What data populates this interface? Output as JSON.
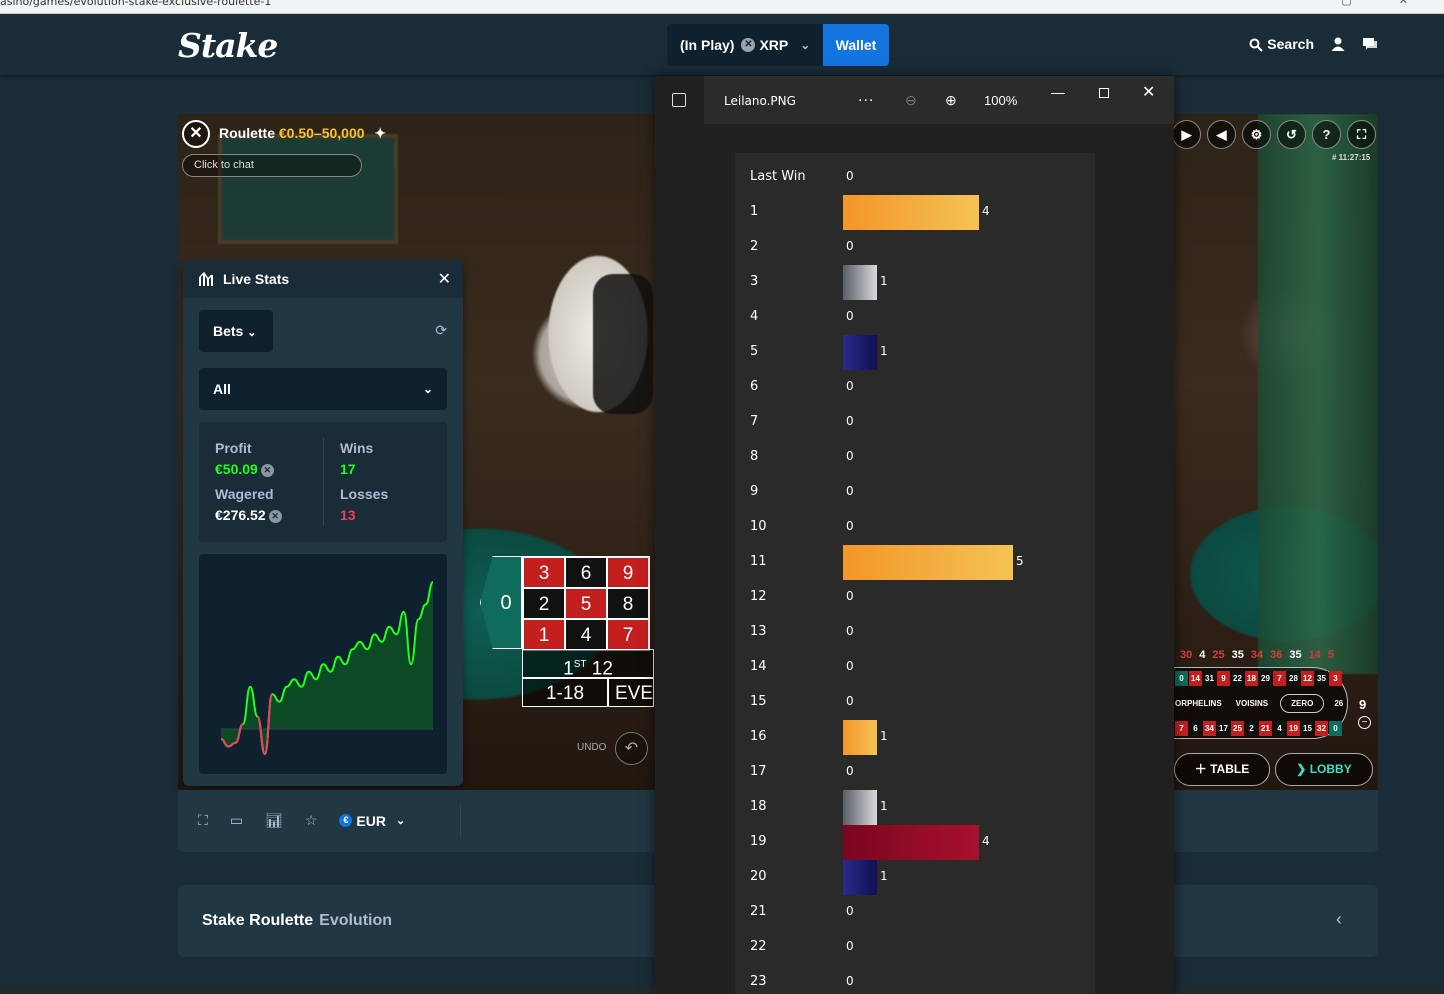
{
  "browser": {
    "url": "asino/games/evolution-stake-exclusive-roulette-1"
  },
  "header": {
    "logo": "Stake",
    "balance_label": "(In Play)",
    "currency": "XRP",
    "wallet_label": "Wallet",
    "search_label": "Search"
  },
  "game": {
    "title": "Roulette",
    "limits": "€0.50–50,000",
    "chat_placeholder": "Click to chat",
    "timestamp": "# 11:27:15",
    "board": {
      "zero": "0",
      "rows": [
        [
          "3",
          "6",
          "9"
        ],
        [
          "2",
          "5",
          "8"
        ],
        [
          "1",
          "4",
          "7"
        ]
      ],
      "row_colors": [
        [
          "red",
          "black",
          "red"
        ],
        [
          "black",
          "red",
          "black"
        ],
        [
          "red",
          "black",
          "red"
        ]
      ],
      "dozen": "1",
      "dozen_suffix": "ST",
      "dozen_value": "12",
      "low": "1-18",
      "even": "EVE"
    },
    "undo_label": "UNDO",
    "history": [
      {
        "v": "30",
        "c": "r"
      },
      {
        "v": "4",
        "c": "w"
      },
      {
        "v": "25",
        "c": "r"
      },
      {
        "v": "35",
        "c": "w"
      },
      {
        "v": "34",
        "c": "r"
      },
      {
        "v": "36",
        "c": "r"
      },
      {
        "v": "35",
        "c": "w"
      },
      {
        "v": "14",
        "c": "r"
      },
      {
        "v": "5",
        "c": "r"
      }
    ],
    "racetrack": {
      "top_row": [
        [
          "0",
          "g"
        ],
        [
          "14",
          "r"
        ],
        [
          "31",
          "b"
        ],
        [
          "9",
          "r"
        ],
        [
          "22",
          "b"
        ],
        [
          "18",
          "r"
        ],
        [
          "29",
          "b"
        ],
        [
          "7",
          "r"
        ],
        [
          "28",
          "b"
        ],
        [
          "12",
          "r"
        ],
        [
          "35",
          "b"
        ],
        [
          "3",
          "r"
        ]
      ],
      "bottom_row": [
        [
          "7",
          "r"
        ],
        [
          "6",
          "b"
        ],
        [
          "34",
          "r"
        ],
        [
          "17",
          "b"
        ],
        [
          "25",
          "r"
        ],
        [
          "2",
          "b"
        ],
        [
          "21",
          "r"
        ],
        [
          "4",
          "b"
        ],
        [
          "19",
          "r"
        ],
        [
          "15",
          "b"
        ],
        [
          "32",
          "r"
        ],
        [
          "0",
          "g"
        ]
      ],
      "sectors": [
        "ORPHELINS",
        "VOISINS",
        "ZERO"
      ],
      "side_values": [
        "26"
      ],
      "count": "9"
    },
    "table_label": "TABLE",
    "lobby_label": "LOBBY"
  },
  "live_stats": {
    "title": "Live Stats",
    "bets_label": "Bets",
    "filter_label": "All",
    "profit_label": "Profit",
    "profit_value": "€50.09",
    "wins_label": "Wins",
    "wins_value": "17",
    "wagered_label": "Wagered",
    "wagered_value": "€276.52",
    "losses_label": "Losses",
    "losses_value": "13"
  },
  "bottom_bar": {
    "currency_label": "EUR"
  },
  "info_bar": {
    "title": "Stake Roulette",
    "provider": "Evolution"
  },
  "viewer": {
    "file_name": "Leilano.PNG",
    "more_label": "...",
    "zoom": "100%"
  },
  "chart_data": {
    "type": "bar",
    "orientation": "horizontal",
    "first_row_label": "Last Win",
    "first_row_value": "0",
    "categories": [
      "1",
      "2",
      "3",
      "4",
      "5",
      "6",
      "7",
      "8",
      "9",
      "10",
      "11",
      "12",
      "13",
      "14",
      "15",
      "16",
      "17",
      "18",
      "19",
      "20",
      "21",
      "22",
      "23"
    ],
    "values": [
      4,
      0,
      1,
      0,
      1,
      0,
      0,
      0,
      0,
      0,
      5,
      0,
      0,
      0,
      0,
      1,
      0,
      1,
      4,
      1,
      0,
      0,
      0
    ],
    "bar_colors": {
      "1": "orange",
      "3": "gray",
      "5": "blue",
      "11": "orange",
      "16": "orange",
      "18": "gray",
      "19": "red",
      "20": "blue"
    },
    "colors": {
      "orange": "#f5a332",
      "gray": "#9ea3a8",
      "blue": "#1e1e7a",
      "red": "#960c28"
    }
  },
  "profit_chart": {
    "type": "area",
    "values": [
      0,
      -1,
      -0.5,
      2,
      7,
      3,
      -2,
      6,
      5,
      7,
      8,
      7,
      9,
      8,
      10,
      9,
      11,
      10,
      12,
      13,
      12,
      14,
      13,
      15,
      14,
      17,
      10,
      16,
      18,
      21
    ]
  }
}
